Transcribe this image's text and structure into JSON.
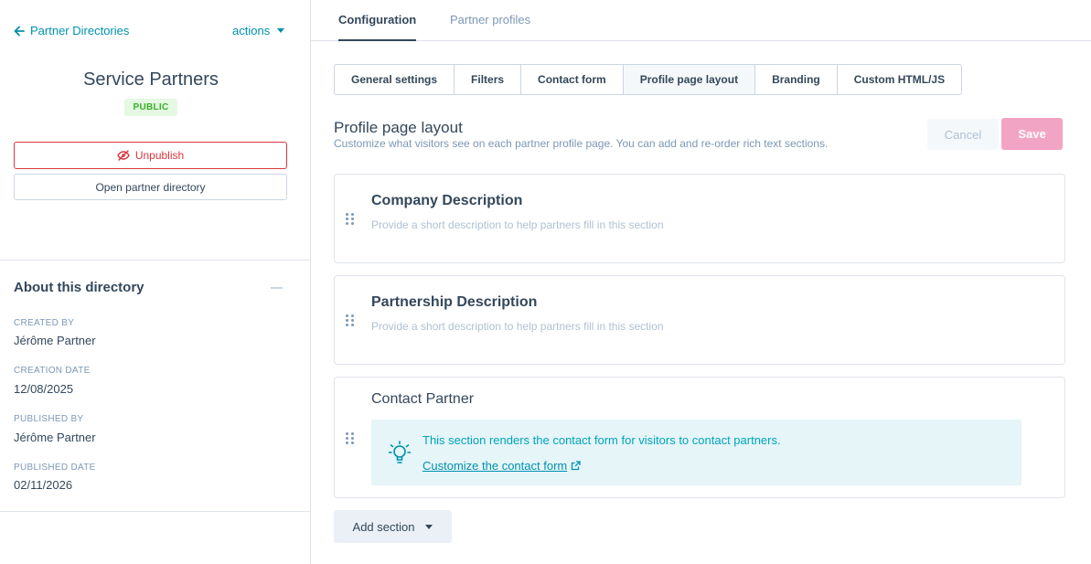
{
  "sidebar": {
    "back_label": "Partner Directories",
    "actions_label": "actions",
    "directory_title": "Service Partners",
    "status_badge": "PUBLIC",
    "unpublish_label": "Unpublish",
    "open_directory_label": "Open partner directory",
    "about": {
      "title": "About this directory",
      "fields": [
        {
          "label": "CREATED BY",
          "value": "Jérôme Partner"
        },
        {
          "label": "CREATION DATE",
          "value": "12/08/2025"
        },
        {
          "label": "PUBLISHED BY",
          "value": "Jérôme Partner"
        },
        {
          "label": "PUBLISHED DATE",
          "value": "02/11/2026"
        }
      ]
    }
  },
  "top_tabs": [
    {
      "label": "Configuration",
      "active": true
    },
    {
      "label": "Partner profiles",
      "active": false
    }
  ],
  "sub_tabs": [
    {
      "label": "General settings"
    },
    {
      "label": "Filters"
    },
    {
      "label": "Contact form"
    },
    {
      "label": "Profile page layout"
    },
    {
      "label": "Branding"
    },
    {
      "label": "Custom HTML/JS"
    }
  ],
  "active_sub_tab": "Profile page layout",
  "layout": {
    "title": "Profile page layout",
    "description": "Customize what visitors see on each partner profile page. You can add and re-order rich text sections.",
    "cancel_label": "Cancel",
    "save_label": "Save",
    "sections": [
      {
        "title": "Company Description",
        "hint": "Provide a short description to help partners fill in this section"
      },
      {
        "title": "Partnership Description",
        "hint": "Provide a short description to help partners fill in this section"
      },
      {
        "title": "Contact Partner",
        "info_text": "This section renders the contact form for visitors to contact partners.",
        "link_text": "Customize the contact form"
      }
    ],
    "add_section_label": "Add section"
  },
  "colors": {
    "accent": "#0091ae",
    "danger": "#d9363e",
    "save_disabled": "#f2a4c4",
    "badge_bg": "#e5f8e2",
    "badge_text": "#36b227",
    "info_bg": "#e5f5f8"
  }
}
